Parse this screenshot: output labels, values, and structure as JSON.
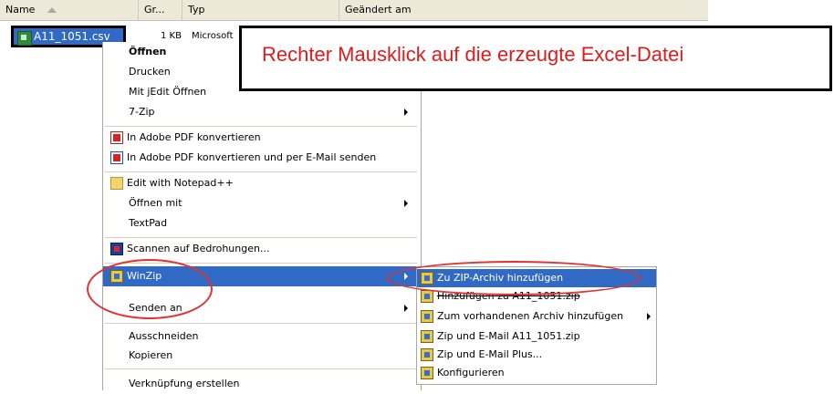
{
  "columns": {
    "name": "Name",
    "size": "Gr...",
    "type": "Typ",
    "modified": "Geändert am"
  },
  "file": {
    "name": "A11_1051.csv",
    "size": "1 KB",
    "type": "Microsoft"
  },
  "callout": {
    "text": "Rechter Mausklick auf die erzeugte Excel-Datei",
    "color": "#e01b1b"
  },
  "context_menu": {
    "items": [
      {
        "label": "Öffnen"
      },
      {
        "label": "Drucken"
      },
      {
        "label": "Mit jEdit Öffnen"
      },
      {
        "label": "7-Zip"
      },
      {
        "label": "In Adobe PDF konvertieren"
      },
      {
        "label": "In Adobe PDF konvertieren und per E-Mail senden"
      },
      {
        "label": "Edit with Notepad++"
      },
      {
        "label": "Öffnen mit"
      },
      {
        "label": "TextPad"
      },
      {
        "label": "Scannen auf Bedrohungen..."
      },
      {
        "label": "WinZip"
      },
      {
        "label": "Senden an"
      },
      {
        "label": "Ausschneiden"
      },
      {
        "label": "Kopieren"
      },
      {
        "label": "Verknüpfung erstellen"
      }
    ]
  },
  "winzip_submenu": {
    "items": [
      {
        "label": "Zu ZIP-Archiv hinzufügen"
      },
      {
        "label": "Hinzufügen zu A11_1051.zip"
      },
      {
        "label": "Zum vorhandenen Archiv hinzufügen"
      },
      {
        "label": "Zip und E-Mail A11_1051.zip"
      },
      {
        "label": "Zip und E-Mail Plus..."
      },
      {
        "label": "Konfigurieren"
      }
    ]
  },
  "colors": {
    "selection": "#316ac5",
    "annotation_red": "#e23232"
  }
}
